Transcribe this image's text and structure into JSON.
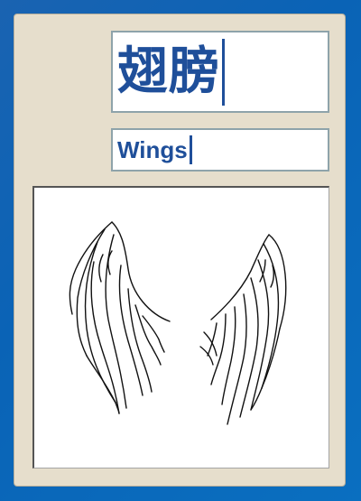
{
  "flashcard": {
    "chinese_word": "翅膀",
    "english_word": "Wings",
    "image_subject": "wings-drawing",
    "text_color": "#1f4f9a",
    "panel_color": "#e6decc"
  }
}
